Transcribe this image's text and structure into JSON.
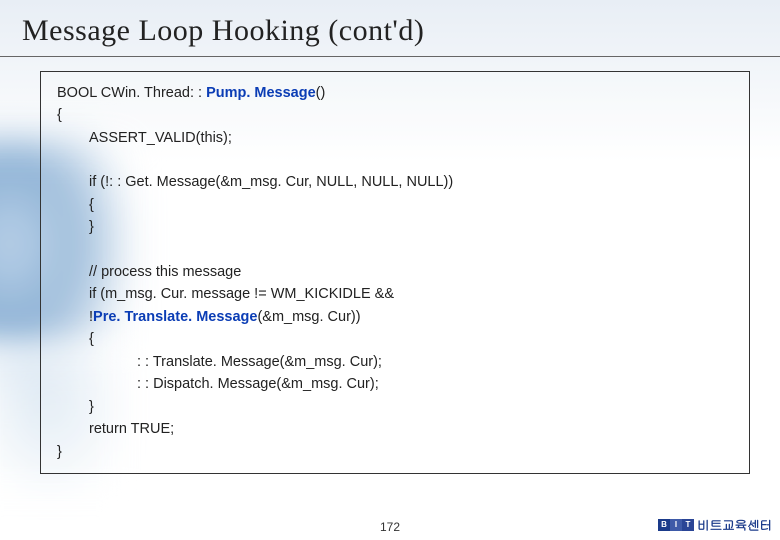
{
  "title": "Message Loop Hooking (cont'd)",
  "code": {
    "l1_pre": "BOOL CWin. Thread: : ",
    "l1_hl": "Pump. Message",
    "l1_post": "()",
    "l2": "{",
    "l3": "ASSERT_VALID(this);",
    "l4": "if (!: : Get. Message(&m_msg. Cur, NULL, NULL, NULL))",
    "l5": "{",
    "l6": "}",
    "l7": "// process this message",
    "l8": "if (m_msg. Cur. message != WM_KICKIDLE &&",
    "l9_pre": "!",
    "l9_hl": "Pre. Translate. Message",
    "l9_post": "(&m_msg. Cur))",
    "l10": "{",
    "l11": ": : Translate. Message(&m_msg. Cur);",
    "l12": ": : Dispatch. Message(&m_msg. Cur);",
    "l13": "}",
    "l14": "return TRUE;",
    "l15": "}"
  },
  "page_number": "172",
  "footer": {
    "logo_letters": {
      "b": "B",
      "i": "I",
      "t": "T"
    },
    "text": "비트교육센터"
  }
}
